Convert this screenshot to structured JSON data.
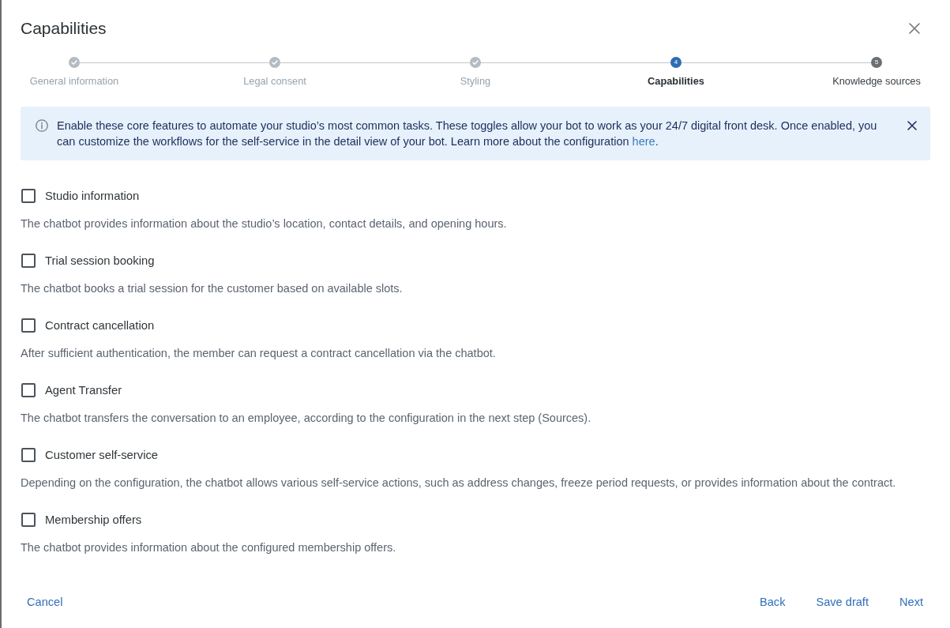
{
  "dialog": {
    "title": "Capabilities"
  },
  "stepper": {
    "steps": [
      {
        "label": "General information",
        "completed": true,
        "selected": false
      },
      {
        "label": "Legal consent",
        "completed": true,
        "selected": false
      },
      {
        "label": "Styling",
        "completed": true,
        "selected": false
      },
      {
        "label": "Capabilities",
        "number": "4",
        "completed": false,
        "selected": true
      },
      {
        "label": "Knowledge sources",
        "number": "5",
        "completed": false,
        "selected": false
      }
    ]
  },
  "info_banner": {
    "text_before_link": "Enable these core features to automate your studio’s most common tasks. These toggles allow your bot to work as your 24/7 digital front desk. Once enabled, you can customize the workflows for the self-service in the detail view of your bot. Learn more about the configuration ",
    "link": "here",
    "text_after_link": "."
  },
  "capabilities": [
    {
      "label": "Studio information",
      "checked": false,
      "description": "The chatbot provides information about the studio’s location, contact details, and opening hours."
    },
    {
      "label": "Trial session booking",
      "checked": false,
      "description": "The chatbot books a trial session for the customer based on available slots."
    },
    {
      "label": "Contract cancellation",
      "checked": false,
      "description": "After sufficient authentication, the member can request a contract cancellation via the chatbot."
    },
    {
      "label": "Agent Transfer",
      "checked": false,
      "description": "The chatbot transfers the conversation to an employee, according to the configuration in the next step (Sources)."
    },
    {
      "label": "Customer self-service",
      "checked": false,
      "description": "Depending on the configuration, the chatbot allows various self-service actions, such as address changes, freeze period requests, or provides information about the contract."
    },
    {
      "label": "Membership offers",
      "checked": false,
      "description": "The chatbot provides information about the configured membership offers."
    }
  ],
  "footer": {
    "cancel": "Cancel",
    "buttons": [
      "Back",
      "Save draft",
      "Next"
    ]
  }
}
